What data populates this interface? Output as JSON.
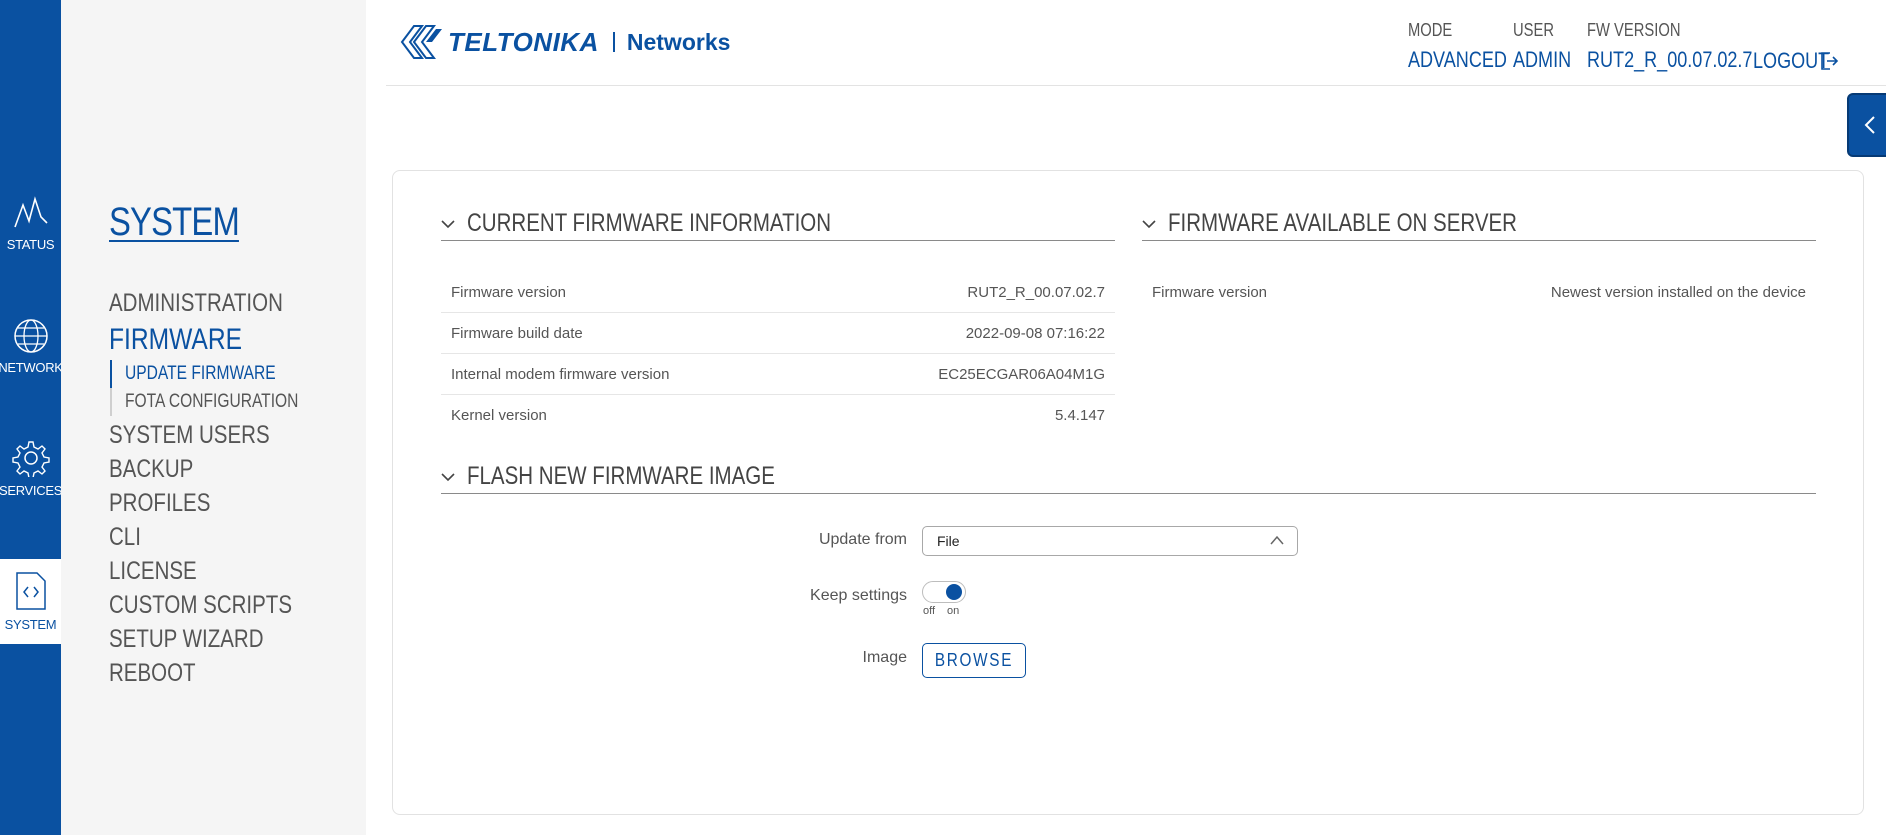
{
  "rail": {
    "items": [
      {
        "label": "STATUS",
        "icon": "status-icon"
      },
      {
        "label": "NETWORK",
        "icon": "globe-icon"
      },
      {
        "label": "SERVICES",
        "icon": "gear-icon"
      },
      {
        "label": "SYSTEM",
        "icon": "system-file-icon"
      }
    ]
  },
  "subnav": {
    "title": "SYSTEM",
    "menu": {
      "administration": "ADMINISTRATION",
      "firmware": "FIRMWARE",
      "firmware_sub": [
        "UPDATE FIRMWARE",
        "FOTA CONFIGURATION"
      ],
      "rest": [
        "SYSTEM USERS",
        "BACKUP",
        "PROFILES",
        "CLI",
        "LICENSE",
        "CUSTOM SCRIPTS",
        "SETUP WIZARD",
        "REBOOT"
      ]
    }
  },
  "header": {
    "brand": "TELTONIKA",
    "brand_suffix": "Networks",
    "mode_label": "MODE",
    "mode_value": "ADVANCED",
    "user_label": "USER",
    "user_value": "ADMIN",
    "fw_label": "FW VERSION",
    "fw_value": "RUT2_R_00.07.02.7",
    "logout": "LOGOUT"
  },
  "current_fw": {
    "title": "CURRENT FIRMWARE INFORMATION",
    "rows": [
      {
        "key": "Firmware version",
        "value": "RUT2_R_00.07.02.7"
      },
      {
        "key": "Firmware build date",
        "value": "2022-09-08 07:16:22"
      },
      {
        "key": "Internal modem firmware version",
        "value": "EC25ECGAR06A04M1G"
      },
      {
        "key": "Kernel version",
        "value": "5.4.147"
      }
    ]
  },
  "server_fw": {
    "title": "FIRMWARE AVAILABLE ON SERVER",
    "rows": [
      {
        "key": "Firmware version",
        "value": "Newest version installed on the device"
      }
    ]
  },
  "flash": {
    "title": "FLASH NEW FIRMWARE IMAGE",
    "update_from_label": "Update from",
    "update_from_value": "File",
    "keep_settings_label": "Keep settings",
    "keep_settings_on": true,
    "toggle_off": "off",
    "toggle_on": "on",
    "image_label": "Image",
    "browse": "BROWSE"
  },
  "colors": {
    "accent": "#0a51a1",
    "rail": "#0a51a1",
    "subnav_bg": "#f5f5f5"
  }
}
